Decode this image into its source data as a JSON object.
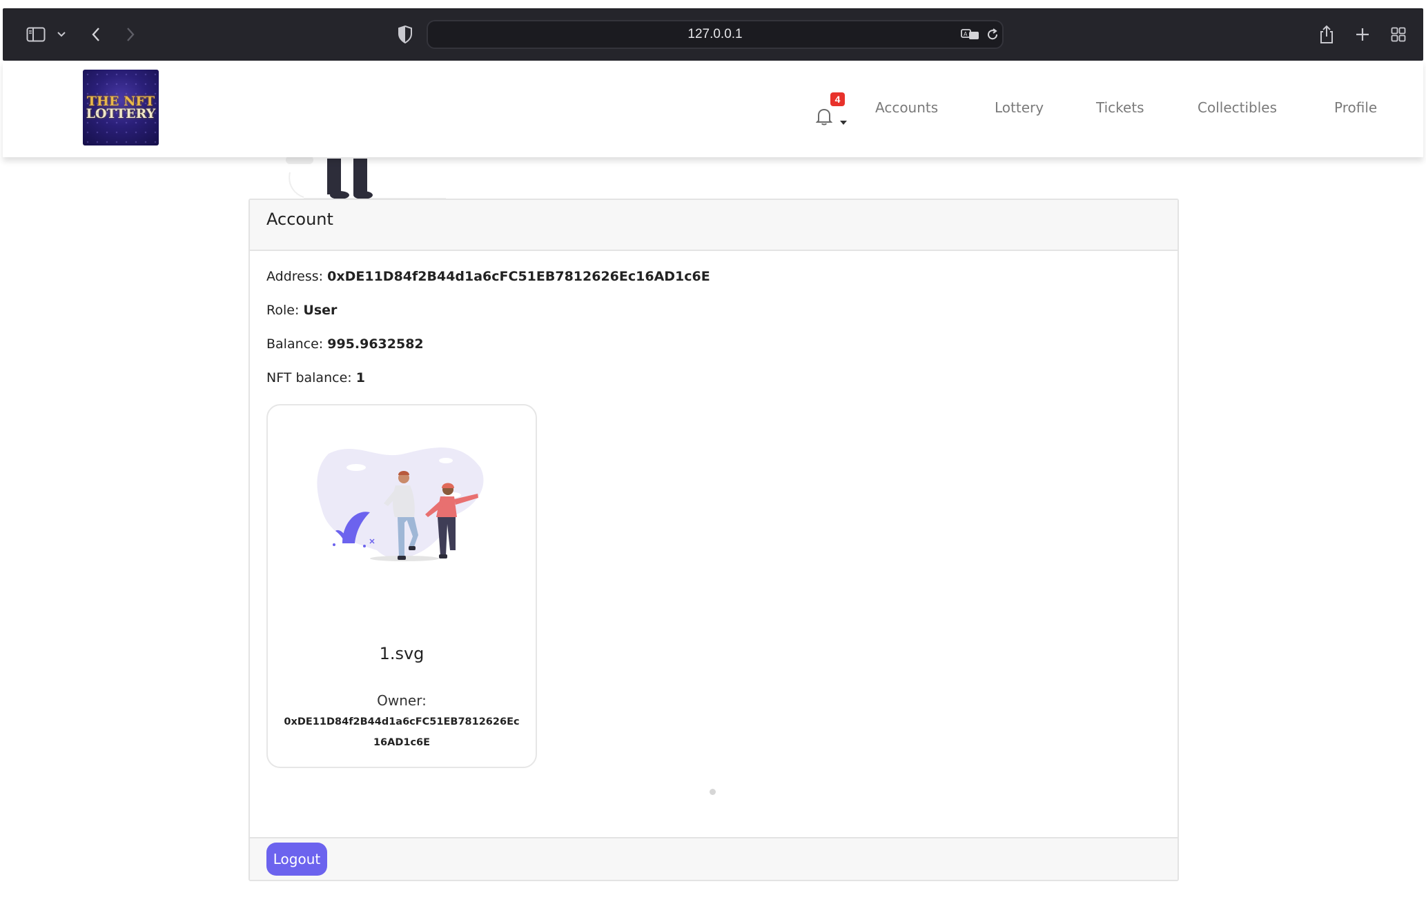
{
  "browser": {
    "url": "127.0.0.1",
    "icons": [
      "sidebar-icon",
      "chevron-down-icon",
      "back-icon",
      "forward-icon",
      "shield-icon",
      "translate-icon",
      "reload-icon",
      "share-icon",
      "new-tab-icon",
      "tab-overview-icon"
    ]
  },
  "header": {
    "logo_line1": "THE NFT",
    "logo_line2": "LOTTERY",
    "notification_count": "4",
    "nav": [
      "Accounts",
      "Lottery",
      "Tickets",
      "Collectibles",
      "Profile"
    ]
  },
  "account": {
    "title": "Account",
    "address_label": "Address:",
    "address": "0xDE11D84f2B44d1a6cFC51EB7812626Ec16AD1c6E",
    "role_label": "Role:",
    "role": "User",
    "balance_label": "Balance:",
    "balance": "995.9632582",
    "nft_balance_label": "NFT balance:",
    "nft_balance": "1"
  },
  "nfts": [
    {
      "name": "1.svg",
      "owner_label": "Owner:",
      "owner": "0xDE11D84f2B44d1a6cFC51EB7812626Ec16AD1c6E"
    }
  ],
  "actions": {
    "logout": "Logout"
  },
  "colors": {
    "accent": "#6c63ee",
    "badge": "#e8322b",
    "chrome": "#25252b"
  }
}
